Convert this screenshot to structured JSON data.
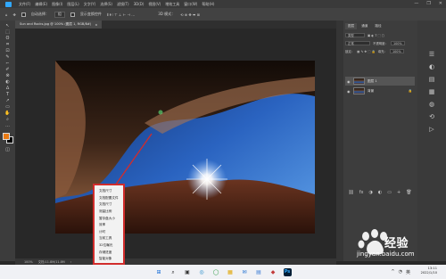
{
  "menubar": {
    "items": [
      "文件(F)",
      "编辑(E)",
      "图像(I)",
      "图层(L)",
      "文字(Y)",
      "选择(S)",
      "滤镜(T)",
      "3D(D)",
      "视图(V)",
      "增效工具",
      "窗口(W)",
      "帮助(H)"
    ],
    "window_controls": [
      "—",
      "❐",
      "✕"
    ]
  },
  "options": {
    "auto_select_label": "自动选择：",
    "auto_select_value": "组",
    "show_transform_label": "显示变换控件"
  },
  "document": {
    "tab_title": "Sun and Rocks.jpg @ 100% (图层 1, RGB/8#)",
    "tab_close": "×"
  },
  "tools": [
    "↖",
    "⬚",
    "ʘ",
    "⌗",
    "⊡",
    "✎",
    "⌐",
    "✐",
    "⊗",
    "◐",
    "∆",
    "T",
    "↗",
    "▭",
    "✋",
    "⌕",
    "…"
  ],
  "colors": {
    "foreground": "#e87a14",
    "background": "#000000",
    "accent": "#31a8ff",
    "highlight_red": "#d12c2c"
  },
  "panel": {
    "tabs": [
      "图层",
      "通道",
      "路径"
    ],
    "kind_label": "类型",
    "blend_mode": "正常",
    "opacity_label": "不透明度：",
    "opacity_value": "100%",
    "lock_label": "锁定：",
    "fill_label": "填充：",
    "fill_value": "100%",
    "layers": [
      {
        "name": "图层 1",
        "visible": true,
        "selected": true
      },
      {
        "name": "背景",
        "visible": true,
        "selected": false,
        "locked": true
      }
    ],
    "bottom_icons": [
      "⛓",
      "fx",
      "◑",
      "◐",
      "▭",
      "+",
      "🗑"
    ]
  },
  "status": {
    "zoom": "100%",
    "doc_info": "文档:11.8M/11.8M",
    "arrow": "›"
  },
  "context_menu": {
    "items": [
      "文档尺寸",
      "文档配置文件",
      "文档尺寸",
      "测量比例",
      "暂存盘大小",
      "效率",
      "计时",
      "当前工具",
      "32位曝光",
      "存储进度",
      "智能对象"
    ]
  },
  "taskbar": {
    "icons": [
      "⊞",
      "⌕",
      "▣",
      "◎",
      "◯",
      "▦",
      "✉",
      "▤",
      "◆",
      "Ps"
    ],
    "time": "13:11",
    "date": "2022/1/10",
    "tray": [
      "^",
      "◔",
      "英"
    ]
  },
  "watermark": {
    "brand_text": "经验",
    "url": "jingyan.baidu.com"
  }
}
